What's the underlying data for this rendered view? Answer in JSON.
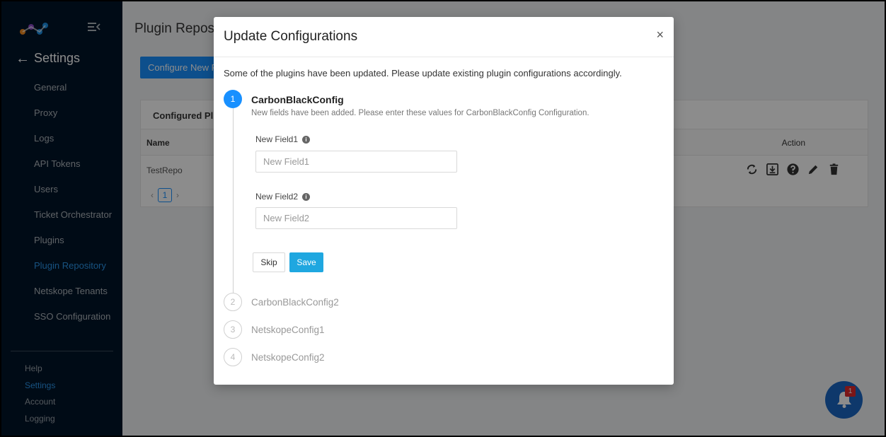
{
  "sidebar": {
    "back_label": "Settings",
    "items": [
      {
        "label": "General"
      },
      {
        "label": "Proxy"
      },
      {
        "label": "Logs"
      },
      {
        "label": "API Tokens"
      },
      {
        "label": "Users"
      },
      {
        "label": "Ticket Orchestrator"
      },
      {
        "label": "Plugins"
      },
      {
        "label": "Plugin Repository",
        "active": true
      },
      {
        "label": "Netskope Tenants"
      },
      {
        "label": "SSO Configuration"
      }
    ],
    "bottom_items": [
      {
        "label": "Help"
      },
      {
        "label": "Settings",
        "active": true
      },
      {
        "label": "Account"
      },
      {
        "label": "Logging"
      }
    ]
  },
  "page": {
    "title": "Plugin Reposi",
    "configure_button": "Configure New P",
    "card_title": "Configured Plu",
    "columns": {
      "name": "Name",
      "action": "Action"
    },
    "row": {
      "name": "TestRepo"
    },
    "current_page": "1",
    "prev": "‹",
    "next": "›"
  },
  "modal": {
    "title": "Update Configurations",
    "close": "×",
    "intro": "Some of the plugins have been updated. Please update existing plugin configurations accordingly.",
    "steps": [
      {
        "number": "1",
        "title": "CarbonBlackConfig",
        "description": "New fields have been added. Please enter these values for CarbonBlackConfig Configuration.",
        "status": "active"
      },
      {
        "number": "2",
        "title": "CarbonBlackConfig2",
        "status": "pending"
      },
      {
        "number": "3",
        "title": "NetskopeConfig1",
        "status": "pending"
      },
      {
        "number": "4",
        "title": "NetskopeConfig2",
        "status": "pending"
      }
    ],
    "fields": [
      {
        "label": "New Field1",
        "placeholder": "New Field1",
        "value": ""
      },
      {
        "label": "New Field2",
        "placeholder": "New Field2",
        "value": ""
      }
    ],
    "skip_label": "Skip",
    "save_label": "Save"
  },
  "notification": {
    "count": "1"
  },
  "colors": {
    "primary": "#1890ff",
    "save": "#1fa7e0",
    "sidebar": "#001529",
    "badge": "#e0282b"
  }
}
